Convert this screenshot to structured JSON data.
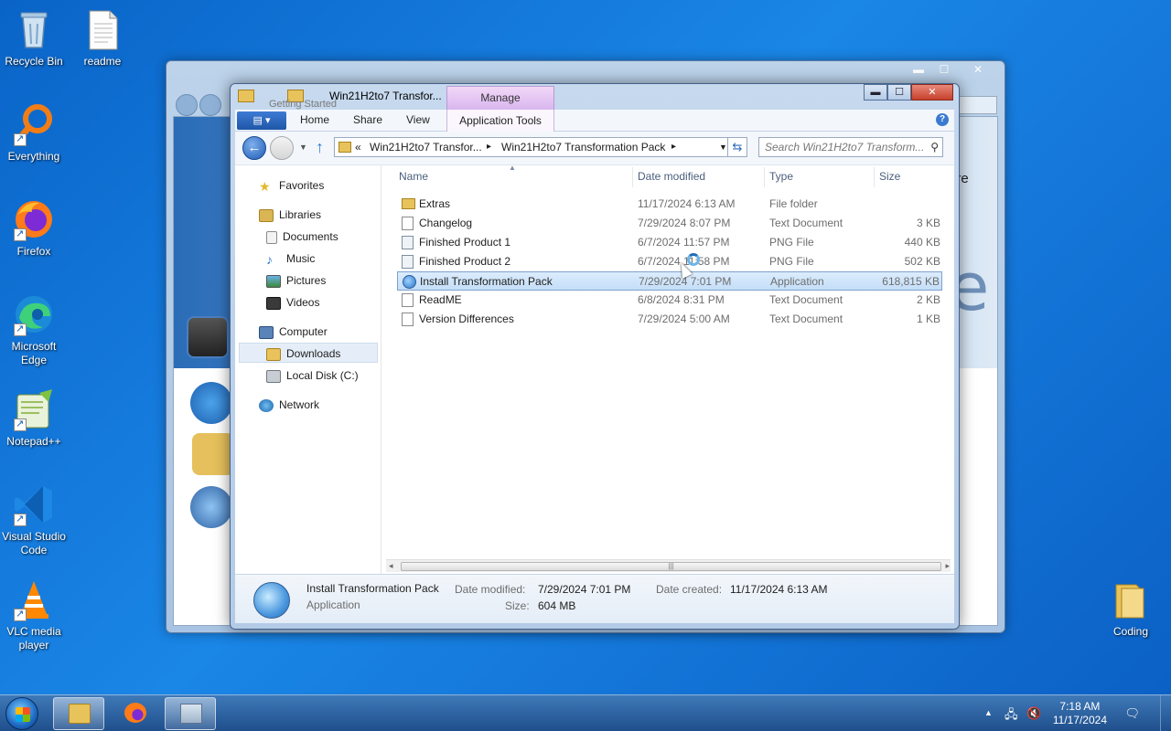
{
  "desktop": {
    "icons": [
      {
        "label": "Recycle Bin",
        "icon": "recycle-bin-icon"
      },
      {
        "label": "readme",
        "icon": "text-file-icon"
      },
      {
        "label": "Everything",
        "icon": "everything-search-icon"
      },
      {
        "label": "Firefox",
        "icon": "firefox-icon"
      },
      {
        "label": "Microsoft Edge",
        "icon": "edge-icon"
      },
      {
        "label": "Notepad++",
        "icon": "notepad-plus-plus-icon"
      },
      {
        "label": "Visual Studio Code",
        "icon": "vscode-icon"
      },
      {
        "label": "VLC media player",
        "icon": "vlc-icon"
      },
      {
        "label": "Coding",
        "icon": "folder-icon"
      }
    ]
  },
  "back_window": {
    "title": "Getting Started",
    "more_text": "ore",
    "big_letter": "e",
    "controls": {
      "minimize": "▬",
      "maximize": "☐",
      "close": "✕"
    }
  },
  "explorer": {
    "title": "Win21H2to7 Transfor...",
    "manage_label": "Manage",
    "controls": {
      "minimize": "▬",
      "maximize": "☐",
      "close": "✕"
    },
    "ribbon": {
      "tabs": [
        "Home",
        "Share",
        "View"
      ],
      "context_tab": "Application Tools",
      "help": "?"
    },
    "address": {
      "chevron": "«",
      "crumb1": "Win21H2to7 Transfor...",
      "crumb2": "Win21H2to7 Transformation Pack",
      "sep": "▸"
    },
    "search_placeholder": "Search Win21H2to7 Transform...",
    "nav": {
      "favorites": "Favorites",
      "libraries": "Libraries",
      "documents": "Documents",
      "music": "Music",
      "pictures": "Pictures",
      "videos": "Videos",
      "computer": "Computer",
      "downloads": "Downloads",
      "local_disk": "Local Disk (C:)",
      "network": "Network"
    },
    "columns": {
      "name": "Name",
      "date": "Date modified",
      "type": "Type",
      "size": "Size"
    },
    "files": [
      {
        "name": "Extras",
        "date": "11/17/2024 6:13 AM",
        "type": "File folder",
        "size": "",
        "icon": "folder-icon"
      },
      {
        "name": "Changelog",
        "date": "7/29/2024 8:07 PM",
        "type": "Text Document",
        "size": "3 KB",
        "icon": "text-file-icon"
      },
      {
        "name": "Finished Product 1",
        "date": "6/7/2024 11:57 PM",
        "type": "PNG File",
        "size": "440 KB",
        "icon": "image-file-icon"
      },
      {
        "name": "Finished Product 2",
        "date": "6/7/2024 11:58 PM",
        "type": "PNG File",
        "size": "502 KB",
        "icon": "image-file-icon"
      },
      {
        "name": "Install Transformation Pack",
        "date": "7/29/2024 7:01 PM",
        "type": "Application",
        "size": "618,815 KB",
        "icon": "installer-app-icon",
        "selected": true
      },
      {
        "name": "ReadME",
        "date": "6/8/2024 8:31 PM",
        "type": "Text Document",
        "size": "2 KB",
        "icon": "text-file-icon"
      },
      {
        "name": "Version Differences",
        "date": "7/29/2024 5:00 AM",
        "type": "Text Document",
        "size": "1 KB",
        "icon": "text-file-icon"
      }
    ],
    "details": {
      "name": "Install Transformation Pack",
      "kind": "Application",
      "modified_label": "Date modified:",
      "modified_value": "7/29/2024 7:01 PM",
      "size_label": "Size:",
      "size_value": "604 MB",
      "created_label": "Date created:",
      "created_value": "11/17/2024 6:13 AM"
    }
  },
  "taskbar": {
    "time": "7:18 AM",
    "date": "11/17/2024",
    "tray_up": "▲"
  },
  "colors": {
    "desktop": "#1a86e6",
    "selection": "#c4def8",
    "taskbar": "#1f4f8c"
  }
}
